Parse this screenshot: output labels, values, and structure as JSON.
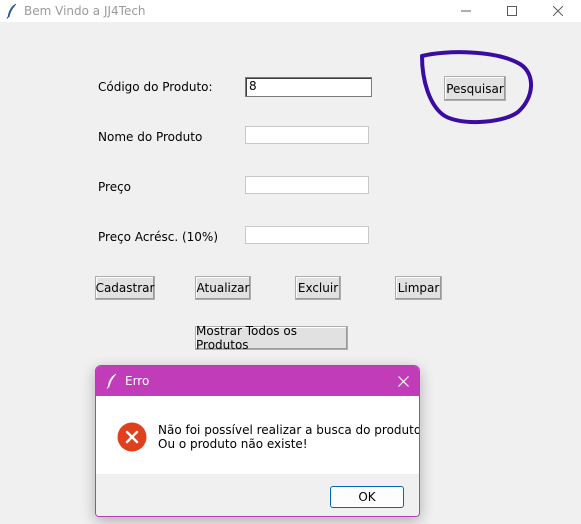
{
  "window": {
    "title": "Bem Vindo a JJ4Tech",
    "icon": "feather-icon",
    "controls": [
      "minimize-icon",
      "maximize-icon",
      "close-icon"
    ]
  },
  "form": {
    "codigo_label": "Código do Produto:",
    "codigo_value": "8",
    "nome_label": "Nome do Produto",
    "nome_value": "",
    "preco_label": "Preço",
    "preco_value": "",
    "preco_acresc_label": "Preço Acrésc. (10%)",
    "preco_acresc_value": ""
  },
  "buttons": {
    "pesquisar": "Pesquisar",
    "cadastrar": "Cadastrar",
    "atualizar": "Atualizar",
    "excluir": "Excluir",
    "limpar": "Limpar",
    "mostrar_todos": "Mostrar Todos os Produtos"
  },
  "annotation": {
    "color": "#3a0ca3"
  },
  "dialog": {
    "title": "Erro",
    "icon": "error-icon",
    "message_line1": "Não foi possível realizar a busca do produto.",
    "message_line2": "Ou o produto não existe!",
    "ok_label": "OK",
    "accent_color": "#c13cb8"
  }
}
